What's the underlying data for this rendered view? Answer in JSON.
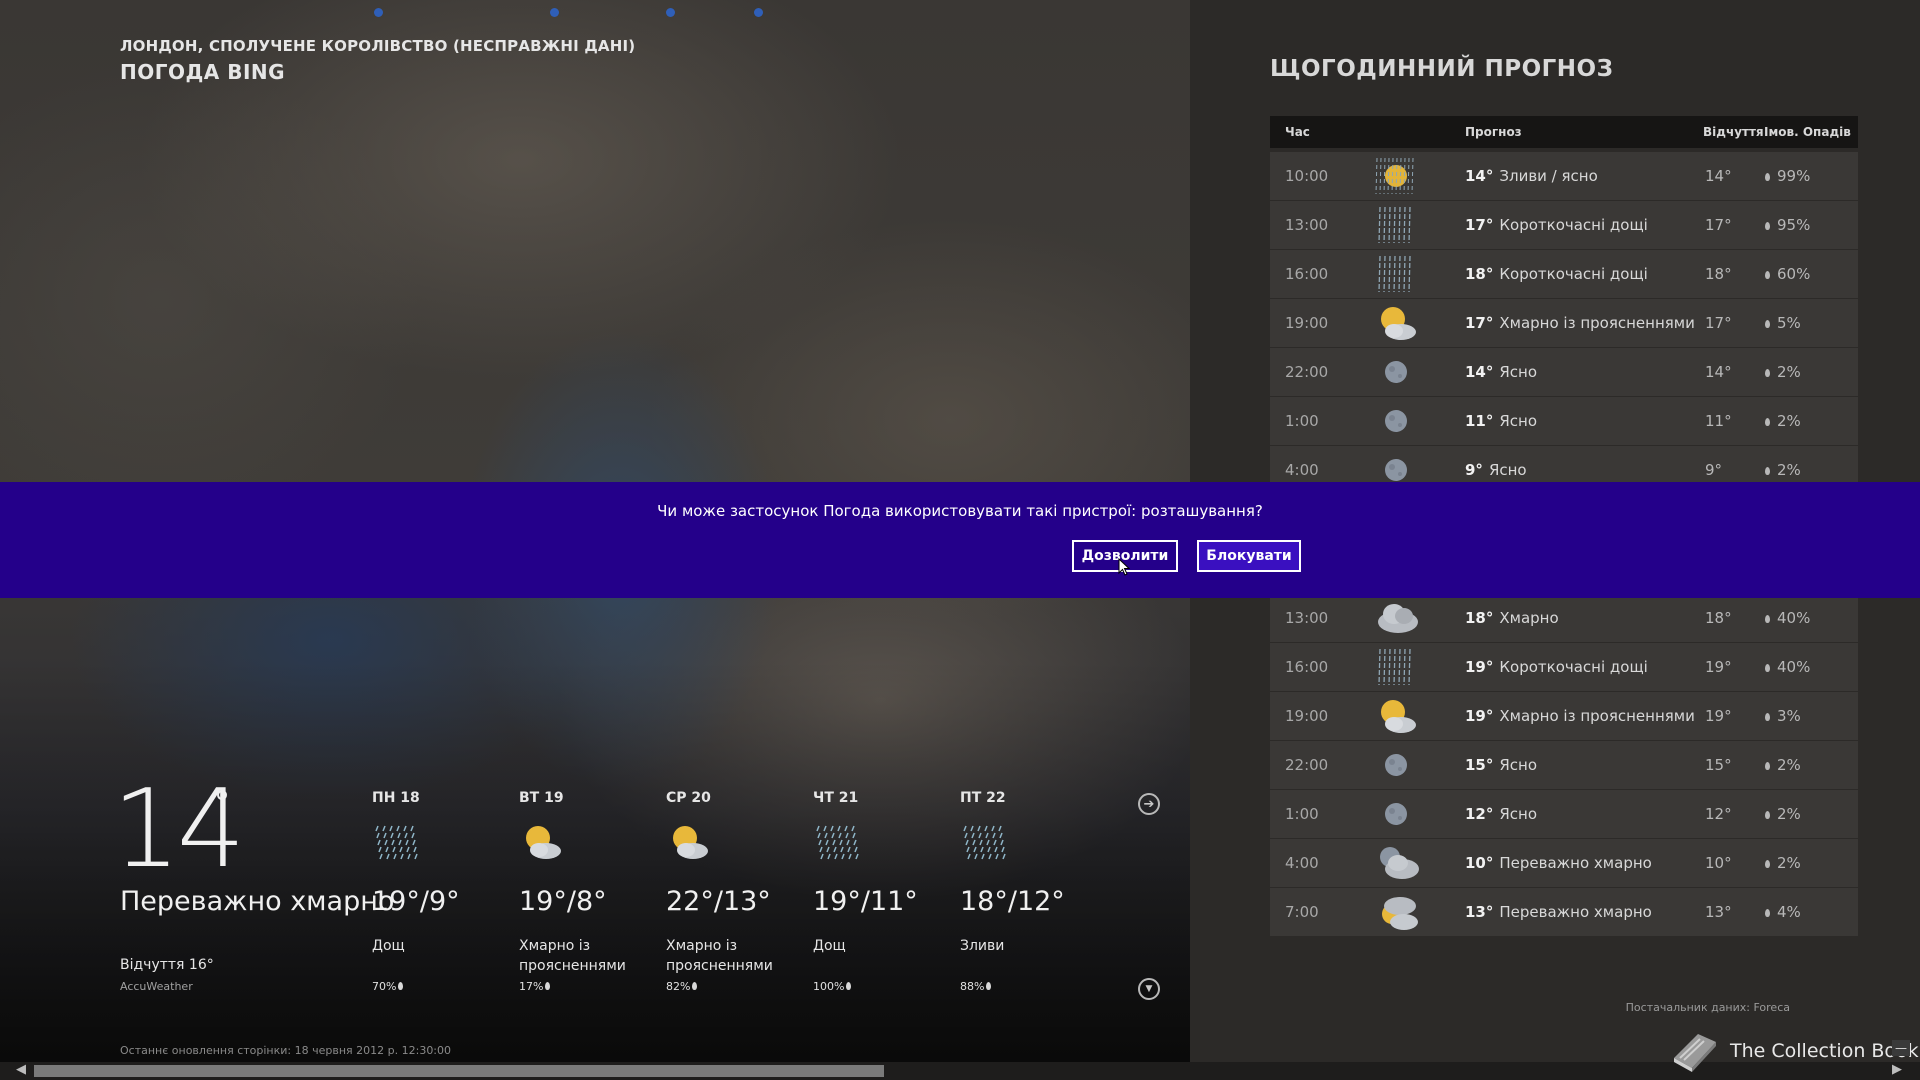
{
  "app": {
    "location": "ЛОНДОН, СПОЛУЧЕНЕ КОРОЛІВСТВО (НЕСПРАВЖНІ ДАНІ)",
    "title": "ПОГОДА BING"
  },
  "current": {
    "temp": "14",
    "deg": "°",
    "condition": "Переважно хмарно",
    "feels": "Відчуття 16°",
    "source": "AccuWeather",
    "last_update": "Останнє оновлення сторінки: 18 червня 2012 р. 12:30:00"
  },
  "daily": [
    {
      "day": "ПН 18",
      "icon": "rain-icon",
      "temps": "19°/9°",
      "cond": "Дощ",
      "precip": "70%"
    },
    {
      "day": "ВТ 19",
      "icon": "partly-cloudy-icon",
      "temps": "19°/8°",
      "cond": "Хмарно із проясненнями",
      "precip": "17%"
    },
    {
      "day": "СР 20",
      "icon": "partly-cloudy-icon",
      "temps": "22°/13°",
      "cond": "Хмарно із проясненнями",
      "precip": "82%"
    },
    {
      "day": "ЧТ 21",
      "icon": "rain-icon",
      "temps": "19°/11°",
      "cond": "Дощ",
      "precip": "100%"
    },
    {
      "day": "ПТ 22",
      "icon": "rain-icon",
      "temps": "18°/12°",
      "cond": "Зливи",
      "precip": "88%"
    }
  ],
  "hourly": {
    "title": "ЩОГОДИННИЙ ПРОГНОЗ",
    "headers": {
      "time": "Час",
      "forecast": "Прогноз",
      "feels": "Відчуття",
      "precip": "Імов. Опадів"
    },
    "rows_top": [
      {
        "time": "10:00",
        "icon": "sun-rain-icon",
        "temp": "14°",
        "cond": "Зливи / ясно",
        "feels": "14°",
        "precip": "99%"
      },
      {
        "time": "13:00",
        "icon": "showers-icon",
        "temp": "17°",
        "cond": "Короткочасні дощі",
        "feels": "17°",
        "precip": "95%"
      },
      {
        "time": "16:00",
        "icon": "showers-icon",
        "temp": "18°",
        "cond": "Короткочасні дощі",
        "feels": "18°",
        "precip": "60%"
      },
      {
        "time": "19:00",
        "icon": "partly-cloudy-icon",
        "temp": "17°",
        "cond": "Хмарно із проясненнями",
        "feels": "17°",
        "precip": "5%"
      },
      {
        "time": "22:00",
        "icon": "moon-icon",
        "temp": "14°",
        "cond": "Ясно",
        "feels": "14°",
        "precip": "2%"
      },
      {
        "time": "1:00",
        "icon": "moon-icon",
        "temp": "11°",
        "cond": "Ясно",
        "feels": "11°",
        "precip": "2%"
      },
      {
        "time": "4:00",
        "icon": "moon-icon",
        "temp": "9°",
        "cond": "Ясно",
        "feels": "9°",
        "precip": "2%"
      }
    ],
    "rows_bottom": [
      {
        "time": "13:00",
        "icon": "cloudy-icon",
        "temp": "18°",
        "cond": "Хмарно",
        "feels": "18°",
        "precip": "40%"
      },
      {
        "time": "16:00",
        "icon": "showers-icon",
        "temp": "19°",
        "cond": "Короткочасні дощі",
        "feels": "19°",
        "precip": "40%"
      },
      {
        "time": "19:00",
        "icon": "partly-cloudy-icon",
        "temp": "19°",
        "cond": "Хмарно із проясненнями",
        "feels": "19°",
        "precip": "3%"
      },
      {
        "time": "22:00",
        "icon": "moon-icon",
        "temp": "15°",
        "cond": "Ясно",
        "feels": "15°",
        "precip": "2%"
      },
      {
        "time": "1:00",
        "icon": "moon-icon",
        "temp": "12°",
        "cond": "Ясно",
        "feels": "12°",
        "precip": "2%"
      },
      {
        "time": "4:00",
        "icon": "moon-cloud-icon",
        "temp": "10°",
        "cond": "Переважно хмарно",
        "feels": "10°",
        "precip": "2%"
      },
      {
        "time": "7:00",
        "icon": "sun-cloud-icon",
        "temp": "13°",
        "cond": "Переважно хмарно",
        "feels": "13°",
        "precip": "4%"
      }
    ],
    "provider": "Постачальник даних: Foreca"
  },
  "dialog": {
    "message": "Чи може застосунок Погода використовувати такі пристрої: розташування?",
    "allow": "Дозволити",
    "block": "Блокувати"
  },
  "watermark": "The Collection Book",
  "colors": {
    "dialog_bg": "#24008a",
    "block_btn": "#3a10c0",
    "progress_dot": "#2f5fb8"
  }
}
